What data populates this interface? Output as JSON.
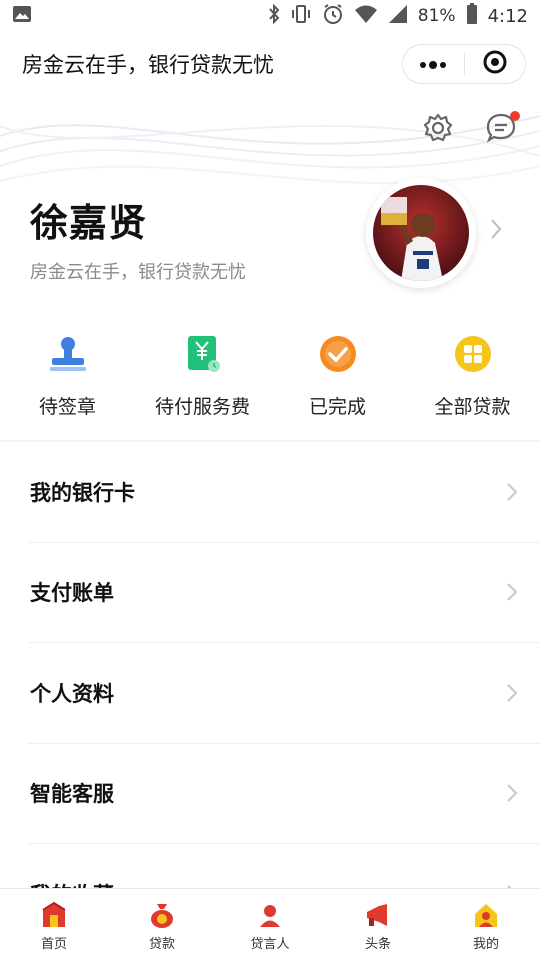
{
  "status_bar": {
    "battery_percent": "81%",
    "time": "4:12"
  },
  "title_bar": {
    "title": "房金云在手，银行贷款无忧"
  },
  "profile": {
    "name": "徐嘉贤",
    "subtitle": "房金云在手，银行贷款无忧"
  },
  "quick_actions": [
    {
      "label": "待签章",
      "icon": "stamp-icon"
    },
    {
      "label": "待付服务费",
      "icon": "yuan-receipt-icon"
    },
    {
      "label": "已完成",
      "icon": "check-circle-icon"
    },
    {
      "label": "全部贷款",
      "icon": "grid-apps-icon"
    }
  ],
  "menu": [
    {
      "label": "我的银行卡"
    },
    {
      "label": "支付账单"
    },
    {
      "label": "个人资料"
    },
    {
      "label": "智能客服"
    },
    {
      "label": "我的收藏"
    }
  ],
  "tabbar": [
    {
      "label": "首页",
      "icon": "home-icon"
    },
    {
      "label": "贷款",
      "icon": "money-bag-icon"
    },
    {
      "label": "贷言人",
      "icon": "speaker-icon"
    },
    {
      "label": "头条",
      "icon": "megaphone-icon"
    },
    {
      "label": "我的",
      "icon": "user-icon"
    }
  ],
  "colors": {
    "accent_blue": "#3f7fe0",
    "accent_green": "#22c179",
    "accent_orange": "#f58a1f",
    "accent_yellow": "#f5c518",
    "tab_red": "#e03a2e",
    "notify_red": "#f03a2a"
  }
}
